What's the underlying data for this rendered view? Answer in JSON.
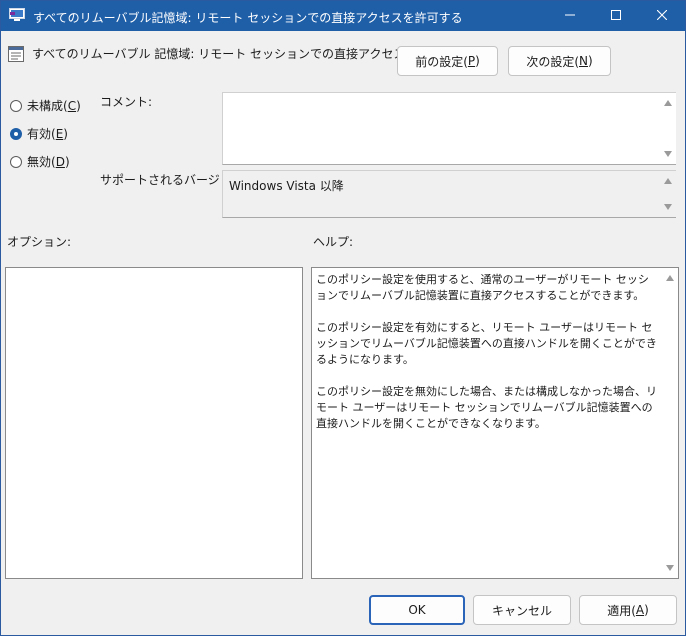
{
  "window": {
    "title": "すべてのリムーバブル記憶域: リモート セッションでの直接アクセスを許可する"
  },
  "header": {
    "policy_name": "すべてのリムーバブル 記憶域: リモート セッションでの直接アクセスを許可する",
    "prev_button": {
      "label": "前の設定(",
      "key": "P",
      "suffix": ")"
    },
    "next_button": {
      "label": "次の設定(",
      "key": "N",
      "suffix": ")"
    }
  },
  "state": {
    "options": [
      {
        "label": "未構成(",
        "key": "C",
        "suffix": ")",
        "selected": false
      },
      {
        "label": "有効(",
        "key": "E",
        "suffix": ")",
        "selected": true
      },
      {
        "label": "無効(",
        "key": "D",
        "suffix": ")",
        "selected": false
      }
    ]
  },
  "comment": {
    "label": "コメント:",
    "value": ""
  },
  "supported": {
    "label": "サポートされるバージョン:",
    "value": "Windows Vista 以降"
  },
  "options_section": {
    "label": "オプション:"
  },
  "help_section": {
    "label": "ヘルプ:",
    "paragraphs": [
      "このポリシー設定を使用すると、通常のユーザーがリモート セッションでリムーバブル記憶装置に直接アクセスすることができます。",
      "このポリシー設定を有効にすると、リモート ユーザーはリモート セッションでリムーバブル記憶装置への直接ハンドルを開くことができるようになります。",
      "このポリシー設定を無効にした場合、または構成しなかった場合、リモート ユーザーはリモート セッションでリムーバブル記憶装置への直接ハンドルを開くことができなくなります。"
    ]
  },
  "footer": {
    "ok": "OK",
    "cancel": "キャンセル",
    "apply": {
      "label": "適用(",
      "key": "A",
      "suffix": ")"
    }
  },
  "colors": {
    "titlebar": "#1f5fa8",
    "accent": "#2a64b8",
    "background": "#f0f0f0"
  }
}
